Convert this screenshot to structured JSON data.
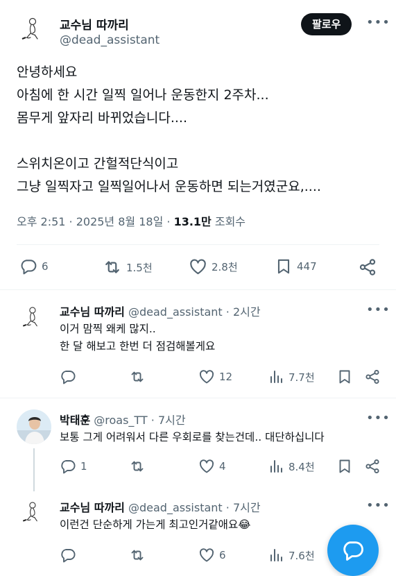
{
  "main_post": {
    "author_name": "교수님 따까리",
    "author_handle": "@dead_assistant",
    "follow_label": "팔로우",
    "lines": [
      "안녕하세요",
      "아침에 한 시간 일찍 일어나 운동한지 2주차...",
      "몸무게 앞자리 바뀌었습니다....",
      "",
      "스위치온이고 간헐적단식이고",
      "그냥 일찍자고 일찍일어나서 운동하면 되는거였군요,...."
    ],
    "timestamp": "오후 2:51 · 2025년 8월 18일 · ",
    "views_count": "13.1만",
    "views_label": " 조회수",
    "stats": {
      "replies": "6",
      "reposts": "1.5천",
      "likes": "2.8천",
      "bookmarks": "447"
    }
  },
  "replies": [
    {
      "author_name": "교수님 따까리",
      "author_handle": "@dead_assistant",
      "time": "· 2시간",
      "lines": [
        "이거 맘찍 왜케 많지..",
        "한 달 해보고 한번 더 점검해볼게요"
      ],
      "replies": "",
      "reposts": "",
      "likes": "12",
      "views": "7.7천"
    },
    {
      "author_name": "박태훈",
      "author_handle": "@roas_TT",
      "time": "· 7시간",
      "lines": [
        "보통 그게 어려워서 다른 우회로를 찾는건데.. 대단하십니다"
      ],
      "replies": "1",
      "reposts": "",
      "likes": "4",
      "views": "8.4천"
    },
    {
      "author_name": "교수님 따까리",
      "author_handle": "@dead_assistant",
      "time": "· 7시간",
      "lines": [
        "이런건 단순하게 가는게 최고인거같애요😂"
      ],
      "replies": "",
      "reposts": "",
      "likes": "6",
      "views": "7.6천"
    }
  ],
  "icons": {
    "more": "more-icon",
    "reply": "reply-icon",
    "repost": "repost-icon",
    "like": "heart-icon",
    "bookmark": "bookmark-icon",
    "share": "share-icon",
    "views": "views-icon",
    "compose": "compose-icon"
  },
  "colors": {
    "accent": "#1d9bf0",
    "text": "#0f1419",
    "secondary": "#536471"
  }
}
